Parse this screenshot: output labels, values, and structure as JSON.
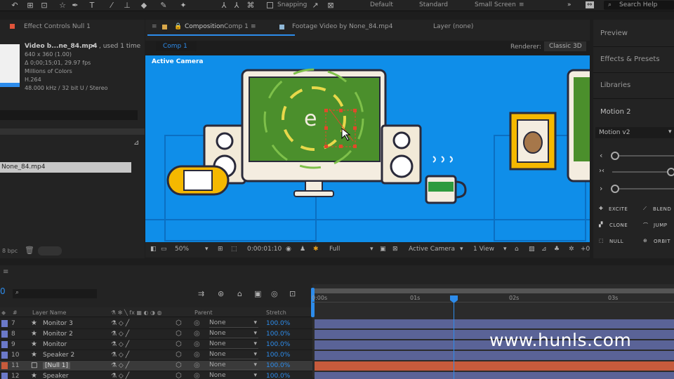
{
  "toolbar": {
    "snapping_label": "Snapping",
    "workspaces": [
      "Default",
      "Standard",
      "Small Screen"
    ],
    "search_placeholder": "Search Help"
  },
  "project_panel": {
    "tab_label": "Effect Controls Null 1",
    "file_name": "Video b...ne_84.mp4",
    "used_label": ", used 1 time",
    "info_lines": [
      "640 x 360 (1.00)",
      "Δ 0;00;15;01, 29.97 fps",
      "Millions of Colors",
      "H.264",
      "48.000 kHz / 32 bit U / Stereo"
    ],
    "selected_item": "None_84.mp4",
    "bpc_label": "8 bpc"
  },
  "comp_panel": {
    "tab_composition": "Composition",
    "comp_name": "Comp 1",
    "tab_footage": "Footage Video by None_84.mp4",
    "tab_layer": "Layer (none)",
    "sub_tab": "Comp 1",
    "renderer_label": "Renderer:",
    "renderer_value": "Classic 3D",
    "active_camera_label": "Active Camera"
  },
  "viewer_bar": {
    "zoom": "50%",
    "timecode": "0:00:01:10",
    "resolution": "Full",
    "camera": "Active Camera",
    "views": "1 View",
    "offset": "+0"
  },
  "right_panel": {
    "items": [
      "Preview",
      "Effects & Presets",
      "Libraries",
      "Motion 2"
    ],
    "dropdown": "Motion v2",
    "buttons": [
      "EXCITE",
      "BLEND",
      "CLONE",
      "JUMP",
      "NULL",
      "ORBIT"
    ]
  },
  "timeline": {
    "search_placeholder": "",
    "columns": {
      "layer_name": "Layer Name",
      "parent": "Parent",
      "stretch": "Stretch"
    },
    "ruler": [
      "0:00s",
      "01s",
      "02s",
      "03s"
    ],
    "layers": [
      {
        "num": "7",
        "name": "Monitor 3",
        "parent": "None",
        "stretch": "100.0%",
        "color": "#6b79c9"
      },
      {
        "num": "8",
        "name": "Monitor 2",
        "parent": "None",
        "stretch": "100.0%",
        "color": "#6b79c9"
      },
      {
        "num": "9",
        "name": "Monitor",
        "parent": "None",
        "stretch": "100.0%",
        "color": "#6b79c9"
      },
      {
        "num": "10",
        "name": "Speaker 2",
        "parent": "None",
        "stretch": "100.0%",
        "color": "#6b79c9"
      },
      {
        "num": "11",
        "name": "[Null 1]",
        "parent": "None",
        "stretch": "100.0%",
        "color": "#c75b3c"
      },
      {
        "num": "12",
        "name": "Speaker",
        "parent": "None",
        "stretch": "100.0%",
        "color": "#6b79c9"
      }
    ]
  },
  "watermark": "www.hunls.com",
  "colors": {
    "accent": "#2d8ceb",
    "viewer_bg": "#0f8ee9",
    "null_bar": "#c75b3c",
    "layer_bar": "#5a6397"
  }
}
